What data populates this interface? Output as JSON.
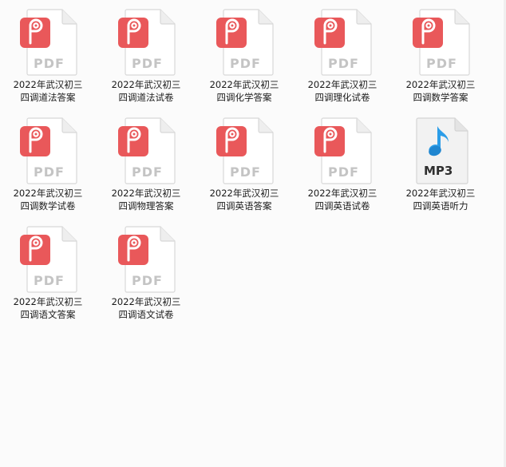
{
  "icons": {
    "pdf": {
      "glyph_text": "PDF",
      "badge_color": "#e9585a",
      "page_color": "#ffffff",
      "text_color": "#c4c4c4"
    },
    "mp3": {
      "glyph_text": "MP3",
      "note_color": "#2b9de8",
      "page_color": "#f2f2f2",
      "text_color": "#2f2f2f"
    }
  },
  "files": [
    {
      "type": "pdf",
      "name_line1": "2022年武汉初三",
      "name_line2": "四调道法答案"
    },
    {
      "type": "pdf",
      "name_line1": "2022年武汉初三",
      "name_line2": "四调道法试卷"
    },
    {
      "type": "pdf",
      "name_line1": "2022年武汉初三",
      "name_line2": "四调化学答案"
    },
    {
      "type": "pdf",
      "name_line1": "2022年武汉初三",
      "name_line2": "四调理化试卷"
    },
    {
      "type": "pdf",
      "name_line1": "2022年武汉初三",
      "name_line2": "四调数学答案"
    },
    {
      "type": "pdf",
      "name_line1": "2022年武汉初三",
      "name_line2": "四调数学试卷"
    },
    {
      "type": "pdf",
      "name_line1": "2022年武汉初三",
      "name_line2": "四调物理答案"
    },
    {
      "type": "pdf",
      "name_line1": "2022年武汉初三",
      "name_line2": "四调英语答案"
    },
    {
      "type": "pdf",
      "name_line1": "2022年武汉初三",
      "name_line2": "四调英语试卷"
    },
    {
      "type": "mp3",
      "name_line1": "2022年武汉初三",
      "name_line2": "四调英语听力"
    },
    {
      "type": "pdf",
      "name_line1": "2022年武汉初三",
      "name_line2": "四调语文答案"
    },
    {
      "type": "pdf",
      "name_line1": "2022年武汉初三",
      "name_line2": "四调语文试卷"
    }
  ]
}
